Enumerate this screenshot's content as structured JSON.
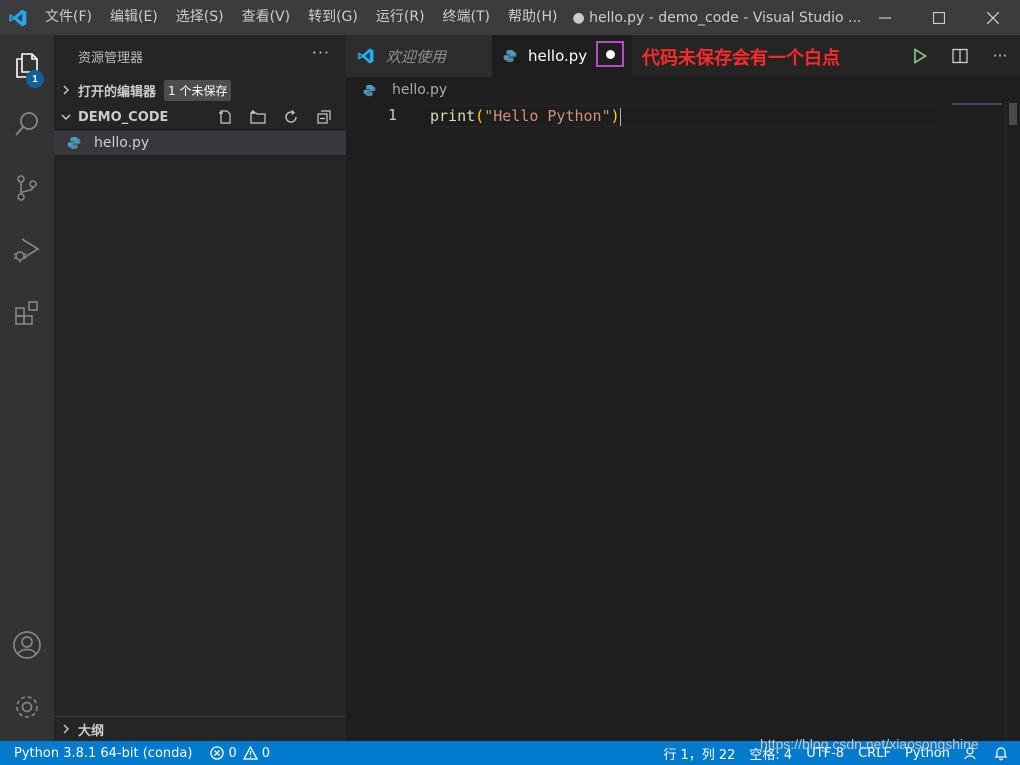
{
  "titlebar": {
    "menu": [
      "文件(F)",
      "编辑(E)",
      "选择(S)",
      "查看(V)",
      "转到(G)",
      "运行(R)",
      "终端(T)",
      "帮助(H)"
    ],
    "window_title": "● hello.py - demo_code - Visual Studio ...",
    "controls": [
      "minimize-icon",
      "maximize-icon",
      "close-icon"
    ]
  },
  "activitybar": {
    "explorer_badge": "1",
    "items": [
      "explorer-icon",
      "search-icon",
      "source-control-icon",
      "run-debug-icon",
      "extensions-icon",
      "account-icon",
      "settings-gear-icon"
    ]
  },
  "sidebar": {
    "title": "资源管理器",
    "more": "···",
    "open_editors_label": "打开的编辑器",
    "open_editors_badge": "1 个未保存",
    "folder_label": "DEMO_CODE",
    "files": [
      {
        "name": "hello.py",
        "icon": "python-file-icon"
      }
    ],
    "outline_label": "大纲"
  },
  "tabs": [
    {
      "label": "欢迎使用",
      "active": false
    },
    {
      "label": "hello.py",
      "active": true,
      "dirty": true
    }
  ],
  "annotation": "代码未保存会有一个白点",
  "breadcrumb": "hello.py",
  "editor": {
    "line_numbers": [
      "1"
    ],
    "code": {
      "func": "print",
      "open": "(",
      "string": "\"Hello Python\"",
      "close": ")"
    }
  },
  "statusbar": {
    "interpreter": "Python 3.8.1 64-bit (conda)",
    "errors": "0",
    "warnings": "0",
    "position": "行 1，列 22",
    "indent": "空格: 4",
    "encoding": "UTF-8",
    "eol": "CRLF",
    "language": "Python"
  },
  "watermark": "https://blog.csdn.net/xiaosongshine",
  "colors": {
    "accent": "#007acc",
    "titlebar": "#3c3c3c",
    "sidebar": "#252526",
    "editor": "#1e1e1e",
    "annotation": "#ff2a2a",
    "highlight_box": "#b34fc2"
  }
}
